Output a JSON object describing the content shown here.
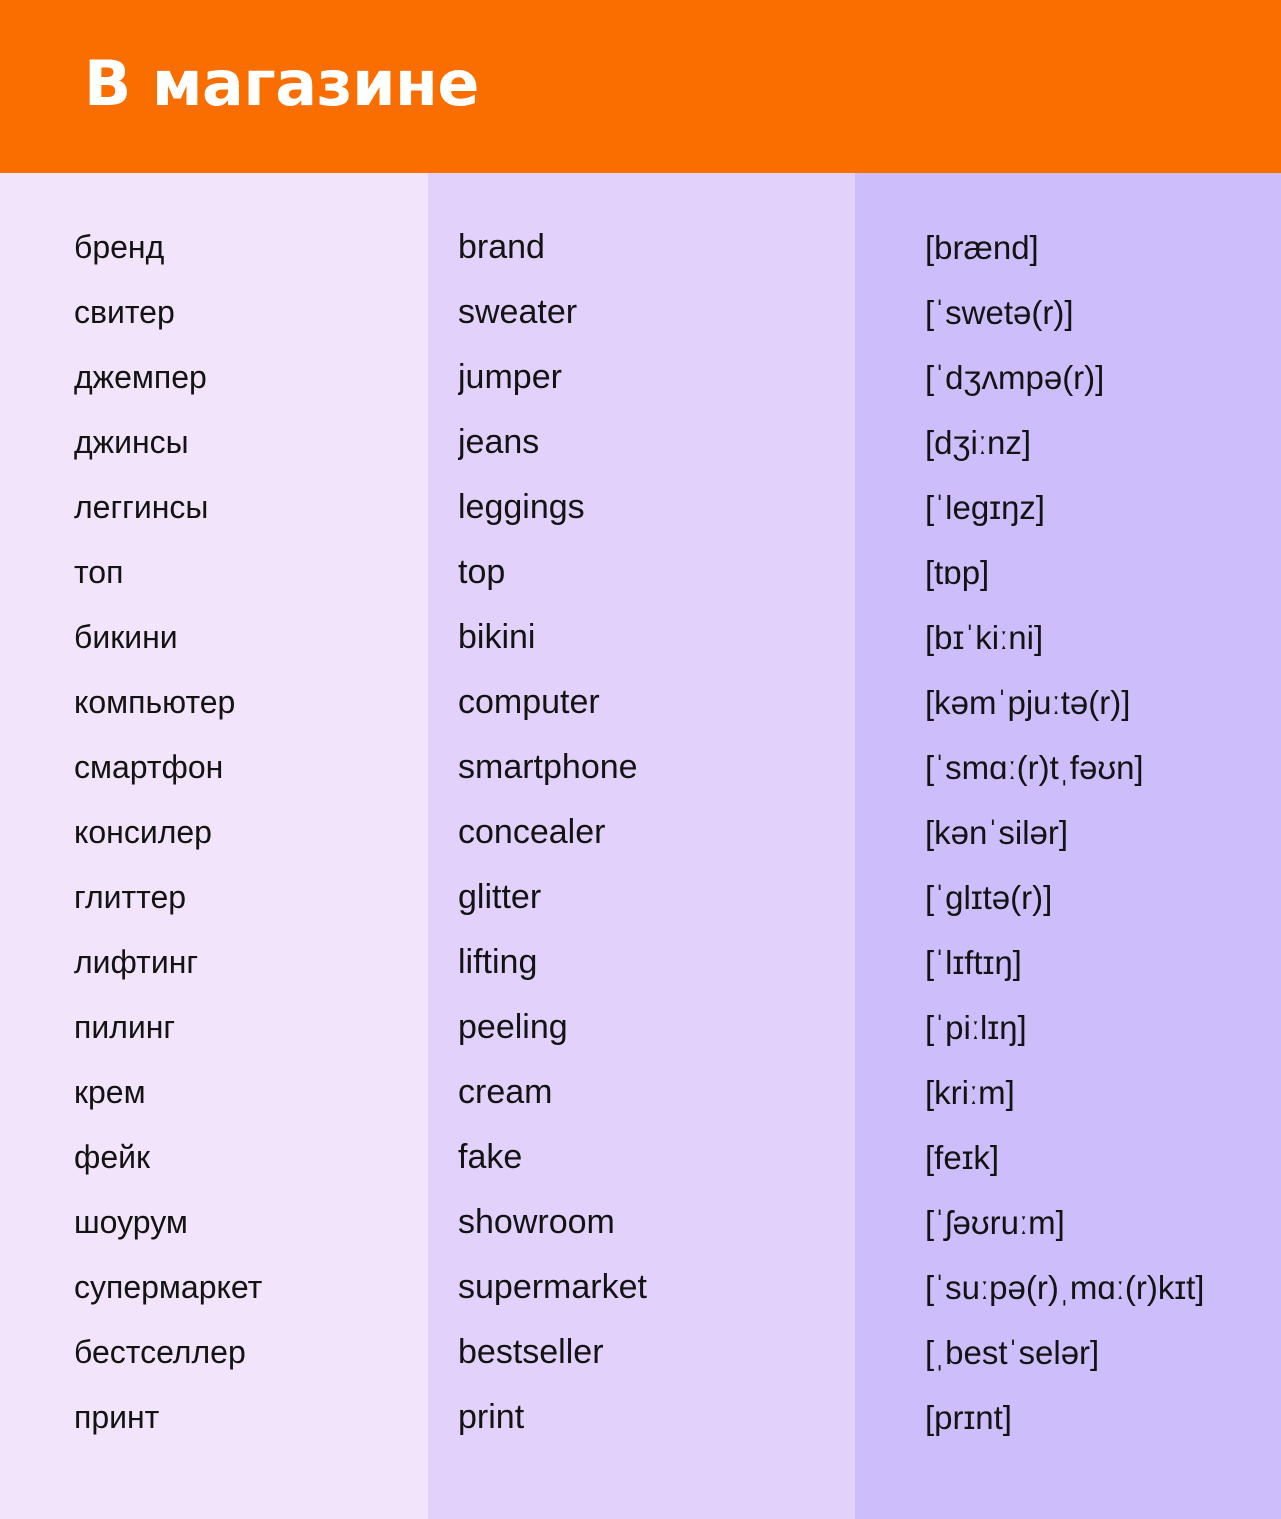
{
  "header": {
    "title": "В магазине",
    "background_color": "#fa6e00",
    "text_color": "#ffffff"
  },
  "columns": {
    "russian": {
      "background_color": "#f2e4fa"
    },
    "english": {
      "background_color": "#e2d2fb"
    },
    "transcription": {
      "background_color": "#cdbdfb"
    }
  },
  "rows": [
    {
      "russian": "бренд",
      "english": "brand",
      "transcription": "[brænd]"
    },
    {
      "russian": "свитер",
      "english": "sweater",
      "transcription": "[ˈswetə(r)]"
    },
    {
      "russian": "джемпер",
      "english": "jumper",
      "transcription": "[ˈdʒʌmpə(r)]"
    },
    {
      "russian": "джинсы",
      "english": "jeans",
      "transcription": "[dʒiːnz]"
    },
    {
      "russian": "леггинсы",
      "english": "leggings",
      "transcription": "[ˈlegɪŋz]"
    },
    {
      "russian": "топ",
      "english": "top",
      "transcription": "[tɒp]"
    },
    {
      "russian": "бикини",
      "english": "bikini",
      "transcription": "[bɪˈkiːni]"
    },
    {
      "russian": "компьютер",
      "english": "computer",
      "transcription": "[kəmˈpjuːtə(r)]"
    },
    {
      "russian": "смартфон",
      "english": "smartphone",
      "transcription": "[ˈsmɑː(r)tˌfəʊn]"
    },
    {
      "russian": "консилер",
      "english": "concealer",
      "transcription": "[kənˈsilər]"
    },
    {
      "russian": "глиттер",
      "english": "glitter",
      "transcription": "[ˈglɪtə(r)]"
    },
    {
      "russian": "лифтинг",
      "english": "lifting",
      "transcription": "[ˈlɪftɪŋ]"
    },
    {
      "russian": "пилинг",
      "english": "peeling",
      "transcription": "[ˈpiːlɪŋ]"
    },
    {
      "russian": "крем",
      "english": "cream",
      "transcription": "[kriːm]"
    },
    {
      "russian": "фейк",
      "english": "fake",
      "transcription": "[feɪk]"
    },
    {
      "russian": "шоурум",
      "english": "showroom",
      "transcription": "[ˈʃəʊruːm]"
    },
    {
      "russian": "супермаркет",
      "english": "supermarket",
      "transcription": "[ˈsuːpə(r)ˌmɑː(r)kɪt]"
    },
    {
      "russian": "бестселлер",
      "english": "bestseller",
      "transcription": "[ˌbestˈselər]"
    },
    {
      "russian": "принт",
      "english": "print",
      "transcription": "[prɪnt]"
    }
  ]
}
